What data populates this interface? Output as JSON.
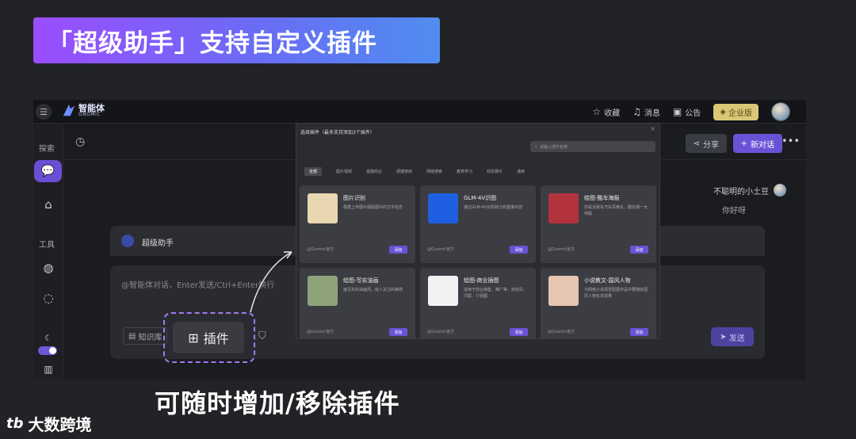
{
  "banner": {
    "title": "「超级助手」支持自定义插件"
  },
  "app": {
    "brand": {
      "name": "智能体",
      "sub": "GNOMIC"
    },
    "top_actions": {
      "favorites": "收藏",
      "messages": "消息",
      "notice": "公告",
      "enterprise": "企业版"
    },
    "sidebar": {
      "explore": "探索",
      "tools": "工具"
    },
    "header": {
      "share": "分享",
      "new_chat": "新对话"
    },
    "chat": {
      "user_name": "不聪明的小土豆",
      "greeting": "你好呀"
    },
    "assistant": {
      "name": "超级助手"
    },
    "input": {
      "placeholder": "@智能体对话，Enter发送/Ctrl+Enter换行",
      "knowledge": "知识库",
      "send": "发送"
    },
    "plugin_button": {
      "label": "插件"
    }
  },
  "modal": {
    "title": "选择插件（最多支持添加3个插件）",
    "search_placeholder": "请输入插件名称",
    "tabs": [
      "全部",
      "图片视频",
      "金融商业",
      "便捷使用",
      "网络搜索",
      "教育学习",
      "轻松娱乐",
      "通用"
    ],
    "active_tab": "全部",
    "cards": [
      {
        "title": "图片识别",
        "desc": "根据上传图片提取图中的文字信息",
        "source": "@Gnomic官方",
        "add": "添加",
        "thumb": "#e8d7b0"
      },
      {
        "title": "GLM-4V识图",
        "desc": "通过GLM-4V识别和分析图像内容",
        "source": "@Gnomic官方",
        "add": "添加",
        "thumb": "#1d5fe0"
      },
      {
        "title": "绘图-酷车海报",
        "desc": "你是当豪车汽车风格化，酷炫潮一大师般",
        "source": "@Gnomic官方",
        "add": "添加",
        "thumb": "#b3333d"
      },
      {
        "title": "绘图-写实油画",
        "desc": "画写实的油画风，给人关注的美感",
        "source": "@Gnomic官方",
        "add": "添加",
        "thumb": "#8fa37a"
      },
      {
        "title": "绘图-商业插图",
        "desc": "适用于商业销售、推广等，启动页、闪屏、介绍图",
        "source": "@Gnomic官方",
        "add": "添加",
        "thumb": "#f2f2f2"
      },
      {
        "title": "小说教文-国风人物",
        "desc": "为网络小说视觉配图作品中要描绘国风人物化定成果",
        "source": "@Gnomic官方",
        "add": "添加",
        "thumb": "#e6c6b2"
      }
    ]
  },
  "caption": "可随时增加/移除插件",
  "watermark": {
    "logo": "tb",
    "text": "大数跨境"
  }
}
